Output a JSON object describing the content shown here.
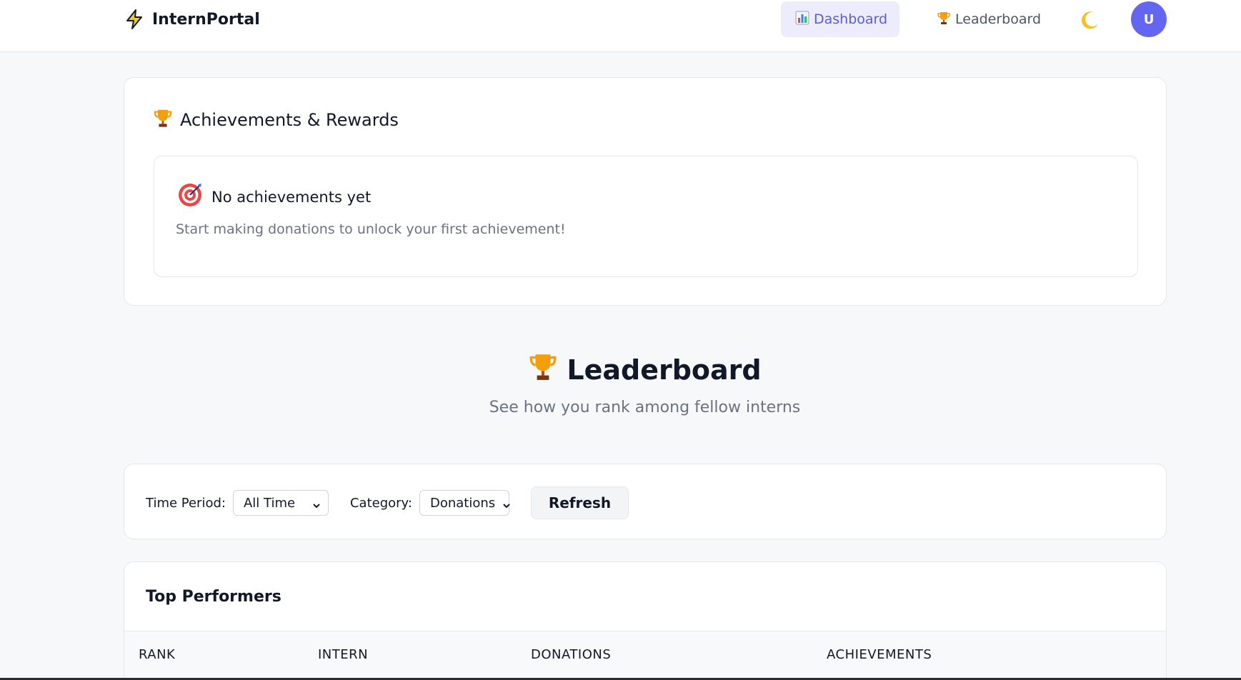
{
  "header": {
    "brand": "InternPortal",
    "nav": [
      {
        "label": "Dashboard",
        "icon": "bar-chart-icon",
        "active": true
      },
      {
        "label": "Leaderboard",
        "icon": "trophy-icon",
        "active": false
      }
    ],
    "theme_toggle_icon": "moon-icon",
    "avatar_initial": "U"
  },
  "achievements": {
    "title": "Achievements & Rewards",
    "empty_title": "No achievements yet",
    "empty_text": "Start making donations to unlock your first achievement!"
  },
  "leaderboard": {
    "title": "Leaderboard",
    "subtitle": "See how you rank among fellow interns"
  },
  "filters": {
    "time_label": "Time Period:",
    "time_value": "All Time",
    "category_label": "Category:",
    "category_value": "Donations",
    "refresh_label": "Refresh"
  },
  "performers": {
    "title": "Top Performers",
    "columns": [
      "RANK",
      "INTERN",
      "DONATIONS",
      "ACHIEVEMENTS"
    ]
  },
  "colors": {
    "accent": "#6366f1",
    "active_nav_bg": "#ececfc",
    "page_bg": "#f7f8fa"
  }
}
